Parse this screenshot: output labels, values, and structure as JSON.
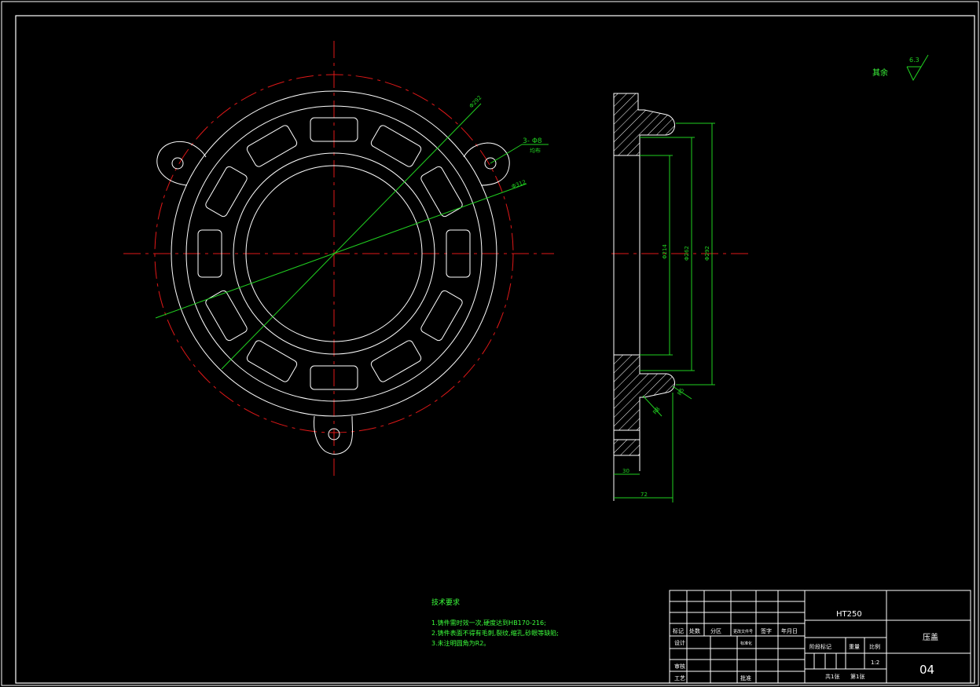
{
  "colors": {
    "outline": "#ffffff",
    "centerline": "#e01818",
    "dimension": "#20d020",
    "text": "#3cff3c",
    "background": "#000000"
  },
  "roughness": {
    "label": "其余",
    "value": "6.3"
  },
  "front_view": {
    "hole_note": "3- Φ8",
    "hole_note_2": "均布",
    "dim_outer": "Φ292",
    "dim_pitch": "Φ312"
  },
  "side_view": {
    "dim_bore": "Φ214",
    "dim_step": "Φ262",
    "dim_flange": "Φ292",
    "dim_radius": "R8",
    "dim_width": "30",
    "dim_total": "72",
    "dim_chamfer": "R5"
  },
  "tech_requirements": {
    "title": "技术要求",
    "items": [
      "1.铸件需时效一次,硬度达到HB170-216;",
      "2.铸件表面不得有毛刺,裂纹,缩孔,砂眼等缺陷;",
      "3.未注明圆角为R2。"
    ]
  },
  "title_block": {
    "material": "HT250",
    "part_name": "压盖",
    "drawing_no": "04",
    "scale_label": "比例",
    "scale": "1:2",
    "weight_label": "重量",
    "stage_label": "阶段标记",
    "sheet_total": "共1张",
    "sheet_no": "第1张",
    "header_row": [
      "标记",
      "处数",
      "分区",
      "更改文件号",
      "签字",
      "年月日"
    ],
    "design": "设计",
    "standard": "标准化",
    "review": "审核",
    "process": "工艺",
    "approve": "批准"
  }
}
